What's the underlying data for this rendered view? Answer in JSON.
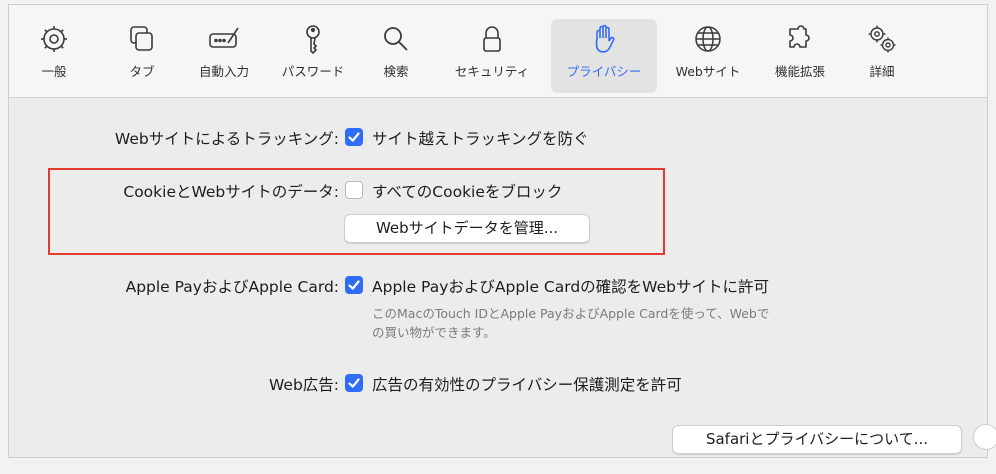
{
  "toolbar": {
    "tabs": [
      {
        "label": "一般",
        "icon": "gear-icon"
      },
      {
        "label": "タブ",
        "icon": "tabs-icon"
      },
      {
        "label": "自動入力",
        "icon": "autofill-icon"
      },
      {
        "label": "パスワード",
        "icon": "key-icon"
      },
      {
        "label": "検索",
        "icon": "search-icon"
      },
      {
        "label": "セキュリティ",
        "icon": "lock-icon"
      },
      {
        "label": "プライバシー",
        "icon": "hand-icon"
      },
      {
        "label": "Webサイト",
        "icon": "globe-icon"
      },
      {
        "label": "機能拡張",
        "icon": "puzzle-icon"
      },
      {
        "label": "詳細",
        "icon": "gears-icon"
      }
    ],
    "selected": "プライバシー"
  },
  "privacy": {
    "tracking": {
      "label": "Webサイトによるトラッキング:",
      "checkbox_label": "サイト越えトラッキングを防ぐ",
      "checked": true
    },
    "cookies": {
      "label": "CookieとWebサイトのデータ:",
      "checkbox_label": "すべてのCookieをブロック",
      "checked": false,
      "manage_button": "Webサイトデータを管理..."
    },
    "apple_pay": {
      "label": "Apple PayおよびApple Card:",
      "checkbox_label": "Apple PayおよびApple Cardの確認をWebサイトに許可",
      "checked": true,
      "note_line1": "このMacのTouch IDとApple PayおよびApple Cardを使って、Webで",
      "note_line2": "の買い物ができます。"
    },
    "web_ads": {
      "label": "Web広告:",
      "checkbox_label": "広告の有効性のプライバシー保護測定を許可",
      "checked": true
    },
    "about_button": "Safariとプライバシーについて..."
  },
  "colors": {
    "accent": "#2f6df6",
    "highlight_box": "#e23b2e"
  }
}
